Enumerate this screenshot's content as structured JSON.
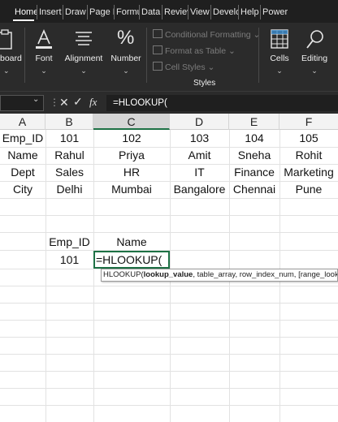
{
  "ribbon_tabs": [
    "Home",
    "Insert",
    "Draw",
    "Page L",
    "Formu",
    "Data",
    "Reviev",
    "View",
    "Develo",
    "Help",
    "Power"
  ],
  "ribbon": {
    "clipboard_label": "board",
    "font_label": "Font",
    "alignment_label": "Alignment",
    "number_label": "Number",
    "styles_items": [
      "Conditional Formatting",
      "Format as Table",
      "Cell Styles"
    ],
    "styles_label": "Styles",
    "cells_label": "Cells",
    "editing_label": "Editing"
  },
  "formula_bar": {
    "fx_label": "fx",
    "formula": "=HLOOKUP("
  },
  "columns": [
    "A",
    "B",
    "C",
    "D",
    "E",
    "F"
  ],
  "table": [
    [
      "Emp_ID",
      "101",
      "102",
      "103",
      "104",
      "105"
    ],
    [
      "Name",
      "Rahul",
      "Priya",
      "Amit",
      "Sneha",
      "Rohit"
    ],
    [
      "Dept",
      "Sales",
      "HR",
      "IT",
      "Finance",
      "Marketing"
    ],
    [
      "City",
      "Delhi",
      "Mumbai",
      "Bangalore",
      "Chennai",
      "Pune"
    ]
  ],
  "lookup": {
    "header_id": "Emp_ID",
    "header_name": "Name",
    "id_value": "101",
    "active_cell_text": "=HLOOKUP("
  },
  "tooltip": {
    "func": "HLOOKUP(",
    "arg1": "lookup_value",
    "rest": ", table_array, row_index_num, [range_lookup])"
  },
  "colors": {
    "accent_green": "#1e7145",
    "ribbon_bg": "#2b2b2b",
    "tab_bg": "#1f1f1f"
  }
}
